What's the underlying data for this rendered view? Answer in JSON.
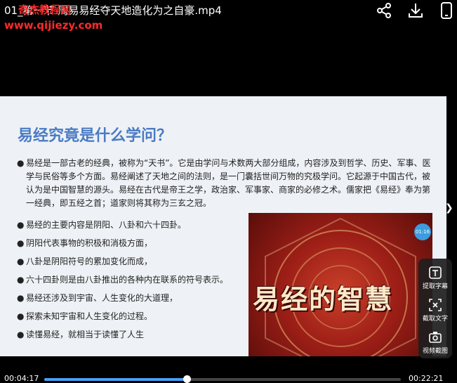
{
  "header": {
    "title": "01_第一节 周易易经夺天地造化为之自豪.mp4",
    "watermark_line1": "奇杰教程网",
    "watermark_line2": "www.qijiezy.com",
    "icons": [
      "share-icon",
      "download-icon",
      "phone-icon"
    ]
  },
  "slide": {
    "title": "易经究竟是什么学问？",
    "paragraph": "易经是一部古老的经典，被称为“天书”。它是由学问与术数两大部分组成，内容涉及到哲学、历史、军事、医学与民俗等多个方面。易经阐述了天地之间的法则，是一门囊括世间万物的究极学问。它起源于中国古代，被认为是中国智慧的源头。易经在古代是帝王之学，政治家、军事家、商家的必修之术。儒家把《易经》奉为第一经典，即五经之首；道家则将其称为三玄之冠。",
    "bullet": "●",
    "items": [
      "易经的主要内容是阴阳、八卦和六十四卦。",
      "阴阳代表事物的积极和消极方面，",
      "八卦是阴阳符号的累加变化而成，",
      "六十四卦则是由八卦推出的各种内在联系的符号表示。",
      "易经还涉及到宇宙、人生变化的大道理，",
      "探索未知宇宙和人生变化的过程。",
      "读懂易经，就相当于读懂了人生"
    ],
    "promo_text": "易经的智慧",
    "badge_text": "01:16"
  },
  "side_panel": {
    "buttons": [
      {
        "label": "提取字幕",
        "icon": "extract-subtitle-icon"
      },
      {
        "label": "截取文字",
        "icon": "capture-text-icon"
      },
      {
        "label": "视频截图",
        "icon": "camera-icon"
      }
    ]
  },
  "player": {
    "current_time": "00:04:17",
    "total_time": "00:22:21",
    "progress": 0.4
  },
  "colors": {
    "slide_title": "#4a7bc4",
    "watermark": "#ff2a2a",
    "progress": "#4a9ff5"
  }
}
